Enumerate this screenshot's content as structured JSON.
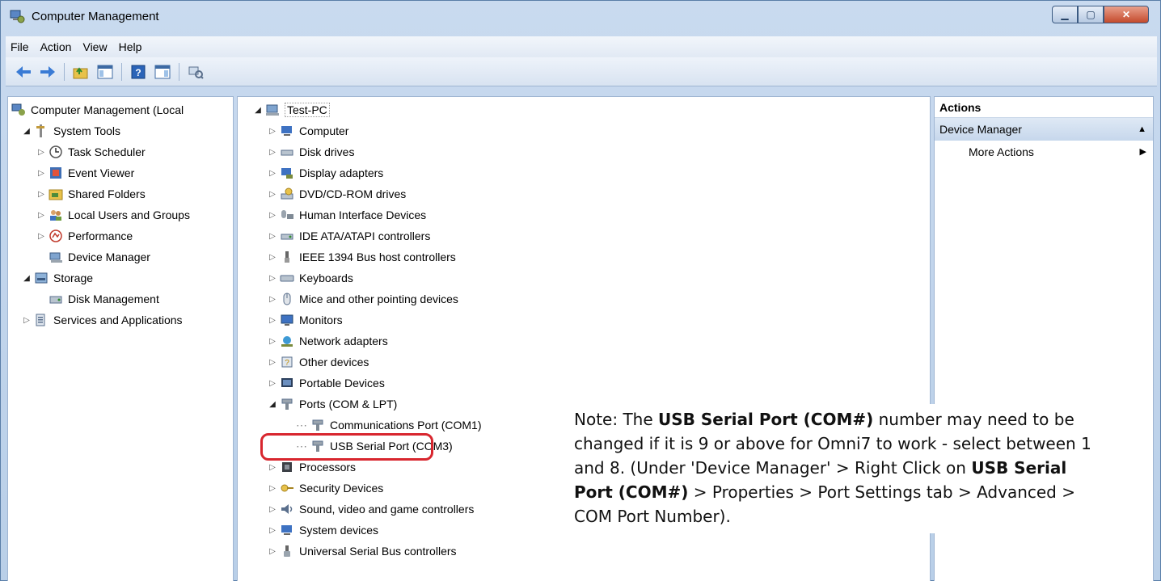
{
  "window": {
    "title": "Computer Management"
  },
  "menubar": [
    "File",
    "Action",
    "View",
    "Help"
  ],
  "left_tree": [
    {
      "label": "Computer Management (Local",
      "level": 0,
      "icon": "computer-management-icon",
      "arrow": ""
    },
    {
      "label": "System Tools",
      "level": 1,
      "icon": "tools-icon",
      "arrow": "open"
    },
    {
      "label": "Task Scheduler",
      "level": 2,
      "icon": "clock-icon",
      "arrow": "closed"
    },
    {
      "label": "Event Viewer",
      "level": 2,
      "icon": "event-viewer-icon",
      "arrow": "closed"
    },
    {
      "label": "Shared Folders",
      "level": 2,
      "icon": "shared-folders-icon",
      "arrow": "closed"
    },
    {
      "label": "Local Users and Groups",
      "level": 2,
      "icon": "users-icon",
      "arrow": "closed"
    },
    {
      "label": "Performance",
      "level": 2,
      "icon": "performance-icon",
      "arrow": "closed"
    },
    {
      "label": "Device Manager",
      "level": 2,
      "icon": "device-manager-icon",
      "arrow": ""
    },
    {
      "label": "Storage",
      "level": 1,
      "icon": "storage-icon",
      "arrow": "open"
    },
    {
      "label": "Disk Management",
      "level": 2,
      "icon": "disk-management-icon",
      "arrow": ""
    },
    {
      "label": "Services and Applications",
      "level": 1,
      "icon": "services-icon",
      "arrow": "closed"
    }
  ],
  "device_tree": {
    "root": "Test-PC",
    "items": [
      "Computer",
      "Disk drives",
      "Display adapters",
      "DVD/CD-ROM drives",
      "Human Interface Devices",
      "IDE ATA/ATAPI controllers",
      "IEEE 1394 Bus host controllers",
      "Keyboards",
      "Mice and other pointing devices",
      "Monitors",
      "Network adapters",
      "Other devices",
      "Portable Devices",
      "Ports (COM & LPT)",
      "Communications Port (COM1)",
      "USB Serial Port (COM3)",
      "Processors",
      "Security Devices",
      "Sound, video and game controllers",
      "System devices",
      "Universal Serial Bus controllers"
    ]
  },
  "actions": {
    "header": "Actions",
    "group": "Device Manager",
    "more": "More Actions"
  },
  "note": {
    "p1": "Note: The ",
    "b1": "USB Serial Port (COM#)",
    "p2": " number may need to be changed if it is 9 or above for Omni7 to work - select between 1 and 8. (Under 'Device Manager' > Right Click on ",
    "b2": "USB Serial Port (COM#)",
    "p3": " > Properties > Port Settings tab > Advanced > COM Port Number)."
  },
  "colors": {
    "highlight": "#d8262e",
    "title_bar": "#c9daef"
  }
}
